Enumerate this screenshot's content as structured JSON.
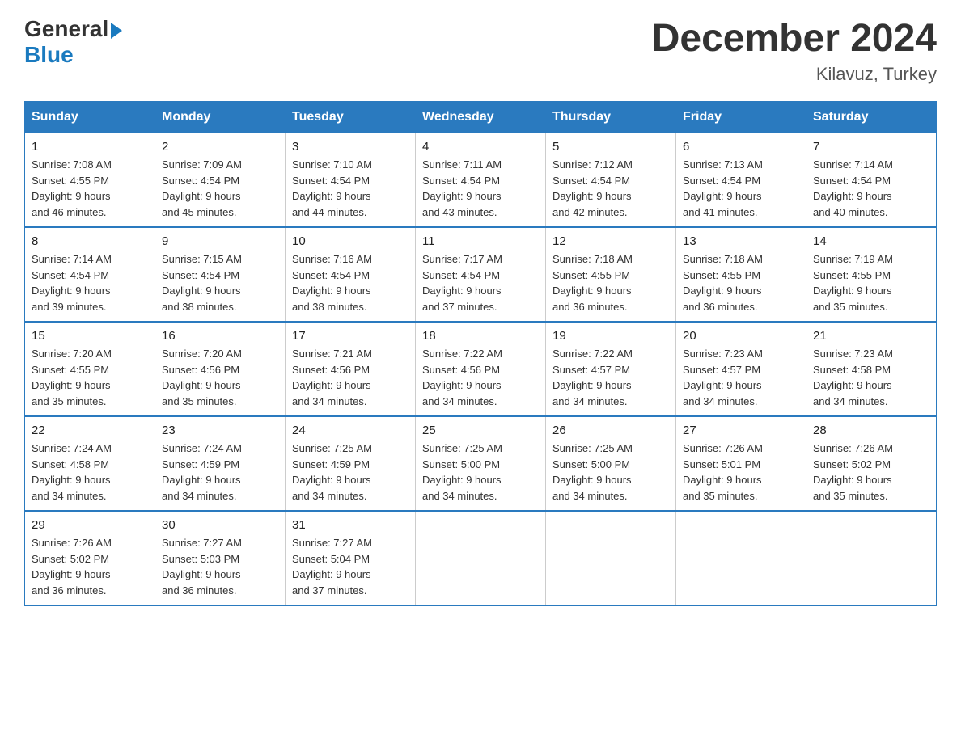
{
  "header": {
    "logo_general": "General",
    "logo_blue": "Blue",
    "main_title": "December 2024",
    "subtitle": "Kilavuz, Turkey"
  },
  "days_of_week": [
    "Sunday",
    "Monday",
    "Tuesday",
    "Wednesday",
    "Thursday",
    "Friday",
    "Saturday"
  ],
  "weeks": [
    [
      {
        "day": "1",
        "sunrise": "7:08 AM",
        "sunset": "4:55 PM",
        "daylight": "9 hours and 46 minutes."
      },
      {
        "day": "2",
        "sunrise": "7:09 AM",
        "sunset": "4:54 PM",
        "daylight": "9 hours and 45 minutes."
      },
      {
        "day": "3",
        "sunrise": "7:10 AM",
        "sunset": "4:54 PM",
        "daylight": "9 hours and 44 minutes."
      },
      {
        "day": "4",
        "sunrise": "7:11 AM",
        "sunset": "4:54 PM",
        "daylight": "9 hours and 43 minutes."
      },
      {
        "day": "5",
        "sunrise": "7:12 AM",
        "sunset": "4:54 PM",
        "daylight": "9 hours and 42 minutes."
      },
      {
        "day": "6",
        "sunrise": "7:13 AM",
        "sunset": "4:54 PM",
        "daylight": "9 hours and 41 minutes."
      },
      {
        "day": "7",
        "sunrise": "7:14 AM",
        "sunset": "4:54 PM",
        "daylight": "9 hours and 40 minutes."
      }
    ],
    [
      {
        "day": "8",
        "sunrise": "7:14 AM",
        "sunset": "4:54 PM",
        "daylight": "9 hours and 39 minutes."
      },
      {
        "day": "9",
        "sunrise": "7:15 AM",
        "sunset": "4:54 PM",
        "daylight": "9 hours and 38 minutes."
      },
      {
        "day": "10",
        "sunrise": "7:16 AM",
        "sunset": "4:54 PM",
        "daylight": "9 hours and 38 minutes."
      },
      {
        "day": "11",
        "sunrise": "7:17 AM",
        "sunset": "4:54 PM",
        "daylight": "9 hours and 37 minutes."
      },
      {
        "day": "12",
        "sunrise": "7:18 AM",
        "sunset": "4:55 PM",
        "daylight": "9 hours and 36 minutes."
      },
      {
        "day": "13",
        "sunrise": "7:18 AM",
        "sunset": "4:55 PM",
        "daylight": "9 hours and 36 minutes."
      },
      {
        "day": "14",
        "sunrise": "7:19 AM",
        "sunset": "4:55 PM",
        "daylight": "9 hours and 35 minutes."
      }
    ],
    [
      {
        "day": "15",
        "sunrise": "7:20 AM",
        "sunset": "4:55 PM",
        "daylight": "9 hours and 35 minutes."
      },
      {
        "day": "16",
        "sunrise": "7:20 AM",
        "sunset": "4:56 PM",
        "daylight": "9 hours and 35 minutes."
      },
      {
        "day": "17",
        "sunrise": "7:21 AM",
        "sunset": "4:56 PM",
        "daylight": "9 hours and 34 minutes."
      },
      {
        "day": "18",
        "sunrise": "7:22 AM",
        "sunset": "4:56 PM",
        "daylight": "9 hours and 34 minutes."
      },
      {
        "day": "19",
        "sunrise": "7:22 AM",
        "sunset": "4:57 PM",
        "daylight": "9 hours and 34 minutes."
      },
      {
        "day": "20",
        "sunrise": "7:23 AM",
        "sunset": "4:57 PM",
        "daylight": "9 hours and 34 minutes."
      },
      {
        "day": "21",
        "sunrise": "7:23 AM",
        "sunset": "4:58 PM",
        "daylight": "9 hours and 34 minutes."
      }
    ],
    [
      {
        "day": "22",
        "sunrise": "7:24 AM",
        "sunset": "4:58 PM",
        "daylight": "9 hours and 34 minutes."
      },
      {
        "day": "23",
        "sunrise": "7:24 AM",
        "sunset": "4:59 PM",
        "daylight": "9 hours and 34 minutes."
      },
      {
        "day": "24",
        "sunrise": "7:25 AM",
        "sunset": "4:59 PM",
        "daylight": "9 hours and 34 minutes."
      },
      {
        "day": "25",
        "sunrise": "7:25 AM",
        "sunset": "5:00 PM",
        "daylight": "9 hours and 34 minutes."
      },
      {
        "day": "26",
        "sunrise": "7:25 AM",
        "sunset": "5:00 PM",
        "daylight": "9 hours and 34 minutes."
      },
      {
        "day": "27",
        "sunrise": "7:26 AM",
        "sunset": "5:01 PM",
        "daylight": "9 hours and 35 minutes."
      },
      {
        "day": "28",
        "sunrise": "7:26 AM",
        "sunset": "5:02 PM",
        "daylight": "9 hours and 35 minutes."
      }
    ],
    [
      {
        "day": "29",
        "sunrise": "7:26 AM",
        "sunset": "5:02 PM",
        "daylight": "9 hours and 36 minutes."
      },
      {
        "day": "30",
        "sunrise": "7:27 AM",
        "sunset": "5:03 PM",
        "daylight": "9 hours and 36 minutes."
      },
      {
        "day": "31",
        "sunrise": "7:27 AM",
        "sunset": "5:04 PM",
        "daylight": "9 hours and 37 minutes."
      },
      null,
      null,
      null,
      null
    ]
  ],
  "labels": {
    "sunrise": "Sunrise:",
    "sunset": "Sunset:",
    "daylight": "Daylight:"
  }
}
